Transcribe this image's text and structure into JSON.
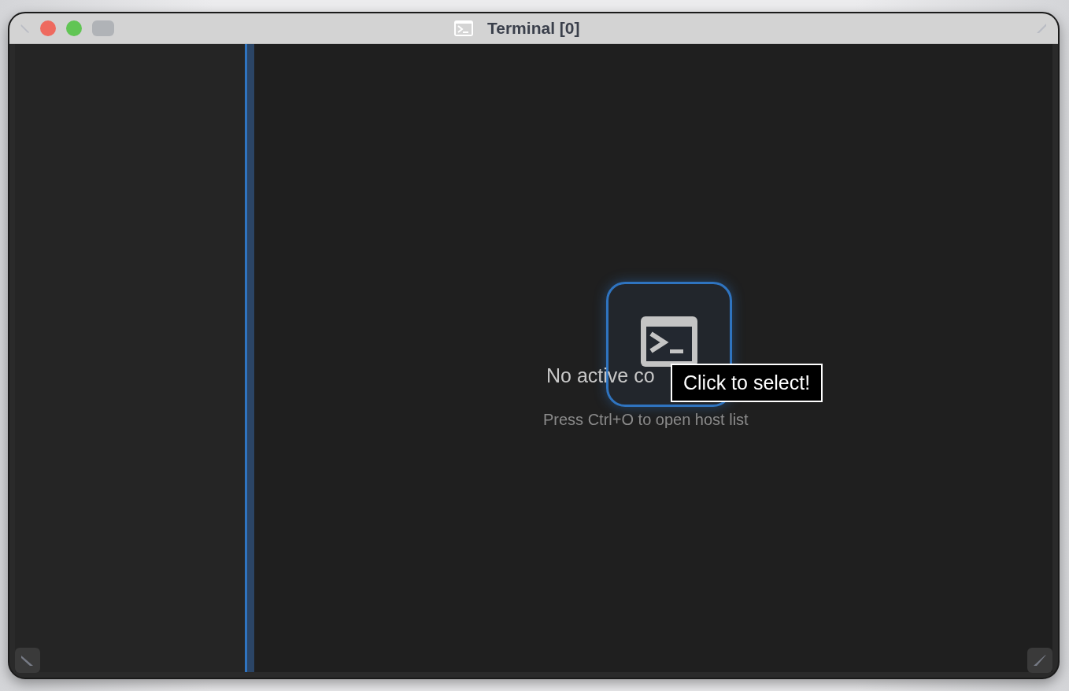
{
  "window": {
    "title": "Terminal [0]"
  },
  "empty_state": {
    "heading": "No active co",
    "hint": "Press Ctrl+O to open host list"
  },
  "tooltip": {
    "text": "Click to select!"
  }
}
